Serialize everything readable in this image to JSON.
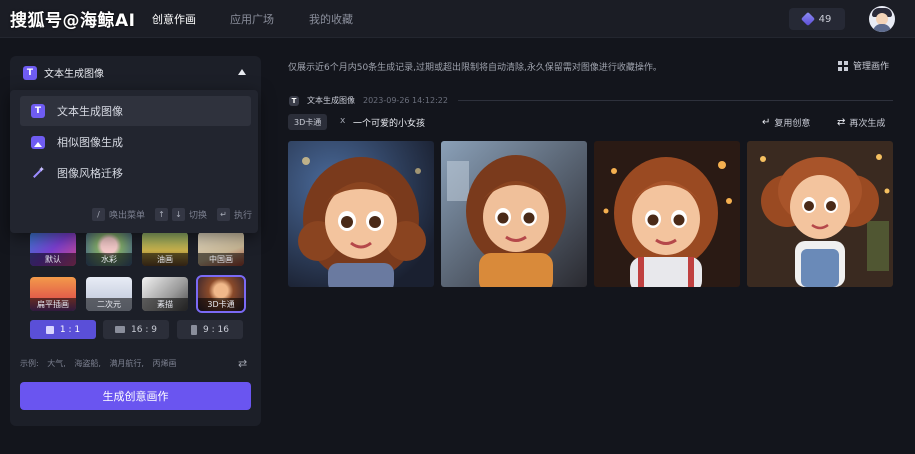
{
  "watermark": "搜狐号@海鲸AI",
  "nav": {
    "tabs": [
      {
        "label": "创意作画",
        "active": true
      },
      {
        "label": "应用广场",
        "active": false
      },
      {
        "label": "我的收藏",
        "active": false
      }
    ]
  },
  "user": {
    "credits": "49"
  },
  "panel": {
    "mode_icon": "T",
    "mode_label": "文本生成图像",
    "menu": [
      {
        "label": "文本生成图像",
        "icon": "text-to-image-icon",
        "selected": true
      },
      {
        "label": "相似图像生成",
        "icon": "similar-image-icon",
        "selected": false
      },
      {
        "label": "图像风格迁移",
        "icon": "style-transfer-icon",
        "selected": false
      }
    ],
    "hints": {
      "menu_key": "/",
      "menu_label": "唤出菜单",
      "switch_key_up": "↑",
      "switch_key_down": "↓",
      "switch_label": "切换",
      "enter_key": "↵",
      "enter_label": "执行"
    },
    "styles": [
      {
        "label": "默认",
        "selected": false
      },
      {
        "label": "水彩",
        "selected": false
      },
      {
        "label": "油画",
        "selected": false
      },
      {
        "label": "中国画",
        "selected": false
      },
      {
        "label": "扁平插画",
        "selected": false
      },
      {
        "label": "二次元",
        "selected": false
      },
      {
        "label": "素描",
        "selected": false
      },
      {
        "label": "3D卡通",
        "selected": true
      }
    ],
    "ratios": [
      {
        "label": "1 : 1",
        "selected": true
      },
      {
        "label": "16 : 9",
        "selected": false
      },
      {
        "label": "9 : 16",
        "selected": false
      }
    ],
    "examples_label": "示例:",
    "examples": [
      "大气,",
      "海盗船,",
      "满月航行,",
      "丙烯画"
    ],
    "generate_label": "生成创意画作"
  },
  "main": {
    "notice": "仅展示近6个月内50条生成记录,过期或超出限制将自动清除,永久保留需对图像进行收藏操作。",
    "manage_label": "管理画作",
    "record": {
      "type_icon": "T",
      "type_label": "文本生成图像",
      "timestamp": "2023-09-26 14:12:22",
      "style_tag": "3D卡通",
      "separator": "x",
      "prompt": "一个可爱的小女孩",
      "reuse_label": "复用创意",
      "regenerate_label": "再次生成"
    }
  },
  "colors": {
    "accent": "#6a55f0",
    "background": "#13151c",
    "panel": "#1c1f28"
  }
}
